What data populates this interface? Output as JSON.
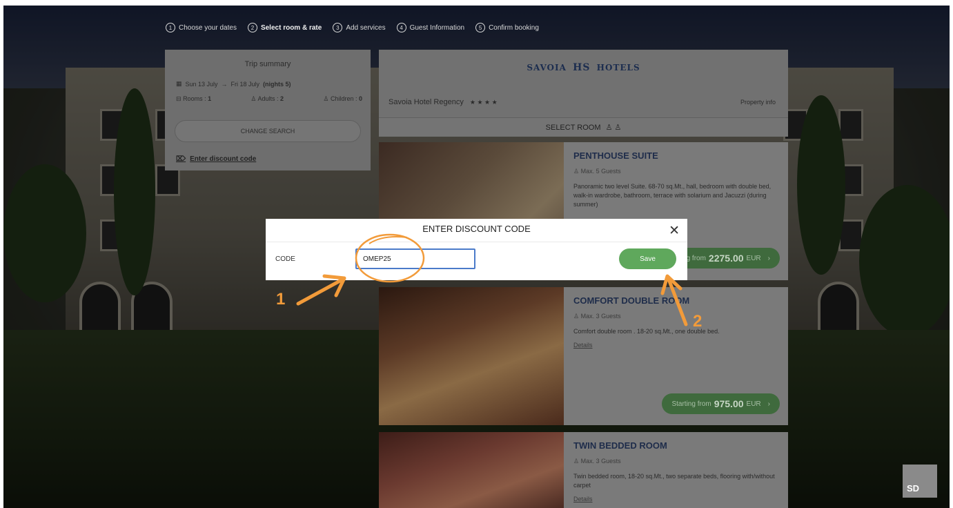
{
  "steps": [
    {
      "num": "1",
      "label": "Choose your dates"
    },
    {
      "num": "2",
      "label": "Select room & rate"
    },
    {
      "num": "3",
      "label": "Add services"
    },
    {
      "num": "4",
      "label": "Guest Information"
    },
    {
      "num": "5",
      "label": "Confirm booking"
    }
  ],
  "trip": {
    "title": "Trip summary",
    "check_in": "Sun 13 July",
    "check_out": "Fri 18 July",
    "nights": "(nights 5)",
    "rooms_label": "Rooms :",
    "rooms": "1",
    "adults_label": "Adults :",
    "adults": "2",
    "children_label": "Children :",
    "children": "0",
    "change_search": "CHANGE SEARCH",
    "discount_link": "Enter discount code"
  },
  "hotel": {
    "logo_left": "SAVOIA",
    "logo_mark": "HS",
    "logo_right": "HOTELS",
    "name": "Savoia Hotel Regency",
    "stars": "★ ★ ★ ★",
    "property_info": "Property info",
    "select_room": "SELECT ROOM"
  },
  "rooms": [
    {
      "name": "PENTHOUSE SUITE",
      "guests": "Max. 5 Guests",
      "desc": "Panoramic two level Suite. 68-70 sq.Mt., hall, bedroom with double bed, walk-in wardrobe, bathroom, terrace with solarium and Jacuzzi (during summer)",
      "details": "",
      "price_prefix": "Starting from",
      "price": "2275.00",
      "currency": "EUR"
    },
    {
      "name": "COMFORT DOUBLE ROOM",
      "guests": "Max. 3 Guests",
      "desc": "Comfort double room . 18-20 sq.Mt., one double bed.",
      "details": "Details",
      "price_prefix": "Starting from",
      "price": "975.00",
      "currency": "EUR"
    },
    {
      "name": "TWIN BEDDED ROOM",
      "guests": "Max. 3 Guests",
      "desc": "Twin bedded room, 18-20 sq.Mt., two separate beds, flooring with/without carpet",
      "details": "Details"
    }
  ],
  "modal": {
    "title": "ENTER DISCOUNT CODE",
    "close": "✕",
    "code_label": "CODE",
    "code_value": "OMEP25",
    "save_label": "Save"
  },
  "annotations": {
    "one": "1",
    "two": "2"
  },
  "badge": "SD",
  "colors": {
    "accent_orange": "#f29b3a",
    "save_green": "#5fa85c",
    "input_border": "#4a7ac9",
    "hotel_navy": "#1c2d4f"
  }
}
